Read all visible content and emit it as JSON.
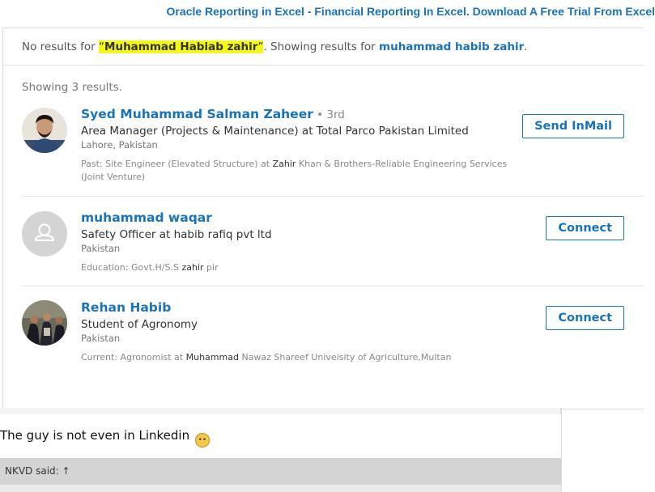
{
  "ad": {
    "text": "Oracle Reporting in Excel - Financial Reporting In Excel. Download A Free Trial From Excel"
  },
  "search": {
    "prefix": "No results for ",
    "open_quote": "“",
    "query": "Muhammad Habiab zahir",
    "close_quote": "”",
    "middle": ". Showing results for ",
    "suggestion": "muhammad habib zahir",
    "suffix": ".",
    "count_text": "Showing 3 results."
  },
  "results": [
    {
      "name": "Syed Muhammad Salman Zaheer",
      "degree": " • 3rd",
      "title": "Area Manager (Projects & Maintenance) at Total Parco Pakistan Limited",
      "location": "Lahore, Pakistan",
      "extra_pre": "Past: Site Engineer (Elevated Structure) at ",
      "extra_bold": "Zahir",
      "extra_post": " Khan & Brothers-Reliable Engineering Services (Joint Venture)",
      "button": "Send InMail"
    },
    {
      "name": "muhammad waqar",
      "title": "Safety Officer at habib rafiq pvt ltd",
      "location": "Pakistan",
      "extra_pre": "Education: Govt.H/S.S ",
      "extra_bold": "zahir",
      "extra_post": " pir",
      "button": "Connect"
    },
    {
      "name": "Rehan Habib",
      "title": "Student of Agronomy",
      "location": "Pakistan",
      "extra_pre": "Current: Agronomist at ",
      "extra_bold": "Muhammad",
      "extra_post": " Nawaz Shareef Univeisity of Agriculture,Multan",
      "button": "Connect"
    }
  ],
  "post": {
    "text": "The guy is not even in Linkedin",
    "emoji": "rolling-eyes-emoji"
  },
  "quote": {
    "header": "NKVD said: ↑"
  },
  "colors": {
    "link": "#1a73b8",
    "highlight": "#f4f71a",
    "quote_bar": "#d4d4d4"
  }
}
